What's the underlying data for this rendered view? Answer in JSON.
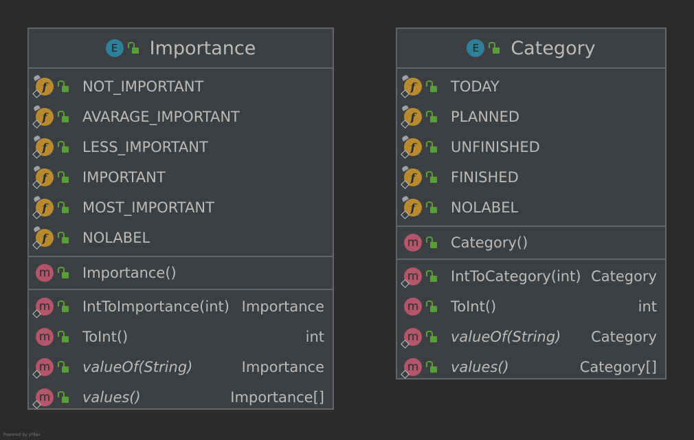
{
  "diagram": {
    "footer": "Powered by yFiles",
    "classes": [
      {
        "badge": "E",
        "title": "Importance",
        "fields": [
          "NOT_IMPORTANT",
          "AVARAGE_IMPORTANT",
          "LESS_IMPORTANT",
          "IMPORTANT",
          "MOST_IMPORTANT",
          "NOLABEL"
        ],
        "constructors": [
          "Importance()"
        ],
        "methods": [
          {
            "name": "IntToImportance(int)",
            "type": "Importance"
          },
          {
            "name": "ToInt()",
            "type": "int"
          },
          {
            "name": "valueOf(String)",
            "type": "Importance"
          },
          {
            "name": "values()",
            "type": "Importance[]"
          }
        ]
      },
      {
        "badge": "E",
        "title": "Category",
        "fields": [
          "TODAY",
          "PLANNED",
          "UNFINISHED",
          "FINISHED",
          "NOLABEL"
        ],
        "constructors": [
          "Category()"
        ],
        "methods": [
          {
            "name": "IntToCategory(int)",
            "type": "Category"
          },
          {
            "name": "ToInt()",
            "type": "int"
          },
          {
            "name": "valueOf(String)",
            "type": "Category"
          },
          {
            "name": "values()",
            "type": "Category[]"
          }
        ]
      }
    ]
  }
}
